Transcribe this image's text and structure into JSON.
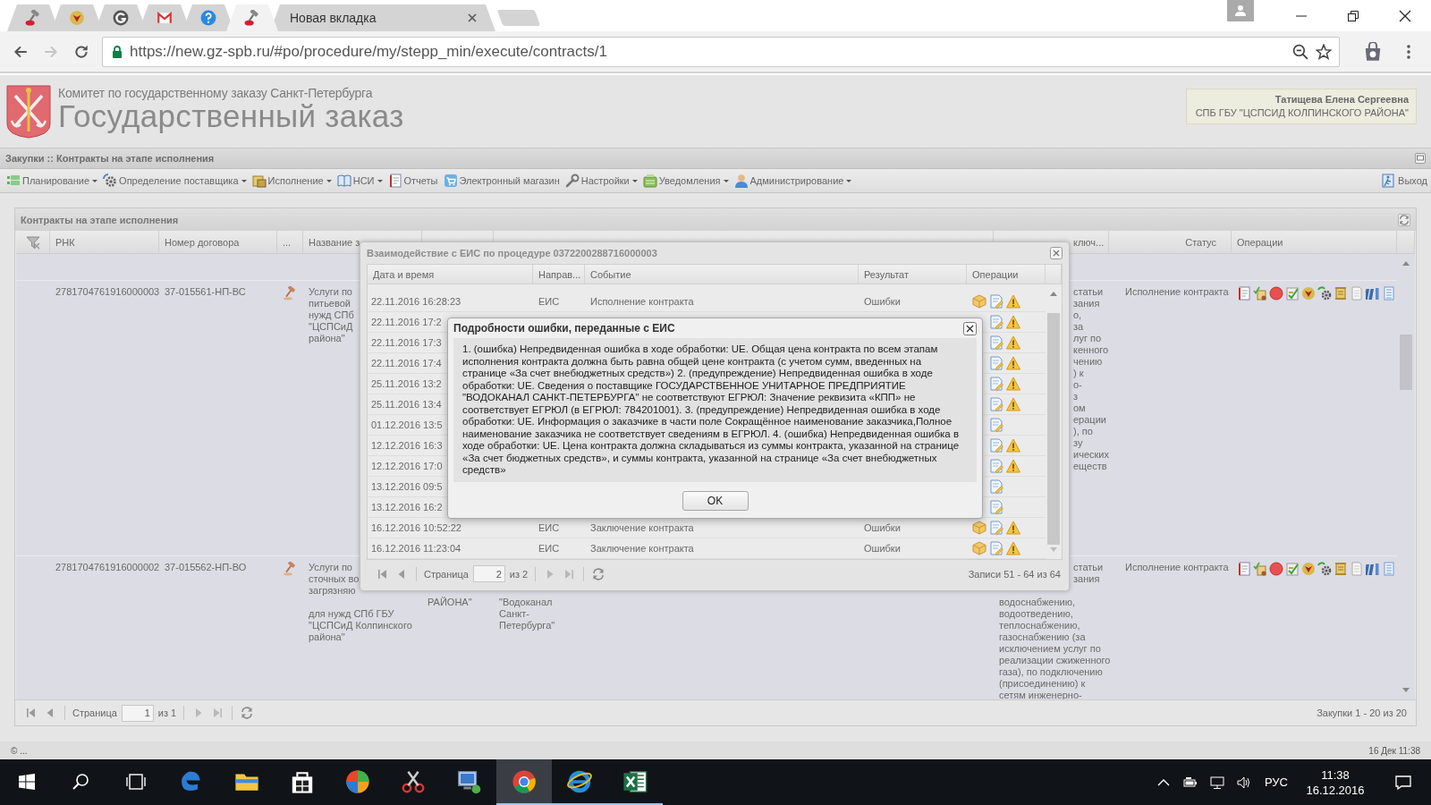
{
  "browser": {
    "tabs": [
      {
        "kind": "gavel",
        "selected": false
      },
      {
        "kind": "emblem",
        "selected": false
      },
      {
        "kind": "g-circle",
        "selected": false
      },
      {
        "kind": "mail",
        "selected": false
      },
      {
        "kind": "help",
        "selected": false
      },
      {
        "kind": "gavel",
        "selected": true
      },
      {
        "kind": "page",
        "title": "Новая вкладка",
        "selected": false
      }
    ],
    "address": "https://new.gz-spb.ru/#po/procedure/my/stepp_min/execute/contracts/1"
  },
  "header": {
    "org": "Комитет по государственному заказу Санкт-Петербурга",
    "title": "Государственный заказ",
    "user_name": "Татищева Елена Сергеевна",
    "user_org": "СПБ ГБУ \"ЦСПСИД КОЛПИНСКОГО РАЙОНА\""
  },
  "breadcrumb": "Закупки :: Контракты на этапе исполнения",
  "menu": [
    {
      "kind": "planning",
      "label": "Планирование",
      "dropdown": true
    },
    {
      "kind": "supplier",
      "label": "Определение поставщика",
      "dropdown": true
    },
    {
      "kind": "execution",
      "label": "Исполнение",
      "dropdown": true
    },
    {
      "kind": "nsi",
      "label": "НСИ",
      "dropdown": true
    },
    {
      "kind": "reports",
      "label": "Отчеты",
      "dropdown": false
    },
    {
      "kind": "shop",
      "label": "Электронный магазин",
      "dropdown": false
    },
    {
      "kind": "settings",
      "label": "Настройки",
      "dropdown": true
    },
    {
      "kind": "notifications",
      "label": "Уведомления",
      "dropdown": true
    },
    {
      "kind": "admin",
      "label": "Администрирование",
      "dropdown": true
    }
  ],
  "logout": "Выход",
  "panel": {
    "title": "Контракты на этапе исполнения",
    "columns": {
      "rnk": "РНК",
      "contract_number": "Номер договора",
      "column_3": "...",
      "name": "Название з",
      "column_9": "ключ...",
      "status": "Статус",
      "operations": "Операции"
    },
    "rows": [
      {
        "rnk": "2781704761916000003",
        "contract_number": "37-015561-НП-ВС",
        "name": [
          "Услуги по",
          "питьевой",
          "нужд СПб",
          "\"ЦСПСиД",
          "района\""
        ],
        "column_9_covered": [
          "статьи",
          "зания",
          "о,",
          "за",
          "луг по",
          "кенного",
          "чению",
          ") к",
          "о-",
          "з",
          "ом",
          "ерации",
          "), по",
          "зу",
          "ических",
          "еществ"
        ],
        "status": "Исполнение контракта"
      },
      {
        "rnk": "2781704761916000002",
        "contract_number": "37-015562-НП-ВО",
        "name": [
          "Услуги по",
          "сточных во",
          "загрязняю"
        ],
        "name_continued": [
          "для нужд СПб ГБУ",
          "\"ЦСПСиД Колпинского",
          "района\""
        ],
        "customer": [
          "РАЙОНА\""
        ],
        "supplier": [
          "\"Водоканал",
          "Санкт-",
          "Петербурга\""
        ],
        "column_9_covered": [
          "статьи",
          "зания"
        ],
        "column_9": [
          "водоснабжению,",
          "водоотведению,",
          "теплоснабжению,",
          "газоснабжению (за",
          "исключением услуг по",
          "реализации сжиженного",
          "газа), по подключению",
          "(присоединению) к",
          "сетям инженерно-"
        ],
        "status": "Исполнение контракта"
      }
    ],
    "pager": {
      "page_label": "Страница",
      "page": "1",
      "of": "из 1",
      "summary": "Закупки 1 - 20 из 20"
    }
  },
  "eis_dialog": {
    "title": "Взаимодействие с ЕИС по процедуре 0372200288716000003",
    "columns": [
      "Дата и время",
      "Направ...",
      "Событие",
      "Результат",
      "Операции"
    ],
    "rows": [
      {
        "date": "22.11.2016 16:28:23",
        "direction": "ЕИС",
        "event": "Исполнение контракта",
        "result": "Ошибки",
        "package": true,
        "document": true,
        "warning": true
      },
      {
        "date": "22.11.2016 17:2",
        "document": true,
        "warning": true
      },
      {
        "date": "22.11.2016 17:3",
        "document": true,
        "warning": true
      },
      {
        "date": "22.11.2016 17:4",
        "document": true,
        "warning": true
      },
      {
        "date": "25.11.2016 13:2",
        "document": true,
        "warning": true
      },
      {
        "date": "25.11.2016 13:4",
        "document": true,
        "warning": true
      },
      {
        "date": "01.12.2016 13:5",
        "document": true,
        "warning": false
      },
      {
        "date": "12.12.2016 16:3",
        "document": true,
        "warning": true
      },
      {
        "date": "12.12.2016 17:0",
        "document": true,
        "warning": true
      },
      {
        "date": "13.12.2016 09:5",
        "document": true,
        "warning": false
      },
      {
        "date": "13.12.2016 16:2",
        "document": true,
        "warning": false
      },
      {
        "date": "16.12.2016 10:52:22",
        "direction": "ЕИС",
        "event": "Заключение контракта",
        "result": "Ошибки",
        "package": true,
        "document": true,
        "warning": true
      },
      {
        "date": "16.12.2016 11:23:04",
        "direction": "ЕИС",
        "event": "Заключение контракта",
        "result": "Ошибки",
        "package": true,
        "document": true,
        "warning": true
      }
    ],
    "pager": {
      "page_label": "Страница",
      "page": "2",
      "of": "из 2",
      "summary": "Записи 51 - 64 из 64"
    }
  },
  "error_dialog": {
    "title": "Подробности ошибки, переданные с ЕИС",
    "message": "1. (ошибка) Непредвиденная ошибка в ходе обработки: UE. Общая цена контракта по всем этапам исполнения контракта должна быть равна общей цене контракта (с учетом сумм, введенных на странице «За счет внебюджетных средств») 2. (предупреждение) Непредвиденная ошибка в ходе обработки: UE. Сведения о поставщике ГОСУДАРСТВЕННОЕ УНИТАРНОЕ ПРЕДПРИЯТИЕ \"ВОДОКАНАЛ САНКТ-ПЕТЕРБУРГА\" не соответствуют ЕГРЮЛ: Значение реквизита «КПП» не соответствует ЕГРЮЛ (в ЕГРЮЛ: 784201001). 3. (предупреждение) Непредвиденная ошибка в ходе обработки: UE. Информация о заказчике в части поле Сокращённое наименование заказчика,Полное наименование заказчика не соответствует сведениям в ЕГРЮЛ. 4. (ошибка) Непредвиденная ошибка в ходе обработки: UE. Цена контракта должна складываться из суммы контракта, указанной на странице «За счет бюджетных средств», и суммы контракта, указанной на странице «За счет внебюджетных средств»",
    "ok": "OK"
  },
  "status_bar": {
    "left": "© ...",
    "right": "16 Дек 11:38"
  },
  "taskbar": {
    "apps": [
      {
        "kind": "edge",
        "running": false,
        "selected": false
      },
      {
        "kind": "explorer",
        "running": false,
        "selected": false
      },
      {
        "kind": "store",
        "running": false,
        "selected": false
      },
      {
        "kind": "pinwheel",
        "running": false,
        "selected": false
      },
      {
        "kind": "tool",
        "running": false,
        "selected": false
      },
      {
        "kind": "network",
        "running": false,
        "selected": false
      },
      {
        "kind": "chrome",
        "running": true,
        "selected": true
      },
      {
        "kind": "ie",
        "running": true,
        "selected": false
      },
      {
        "kind": "excel",
        "running": true,
        "selected": false
      }
    ],
    "language": "РУС",
    "time": "11:38",
    "date": "16.12.2016"
  }
}
